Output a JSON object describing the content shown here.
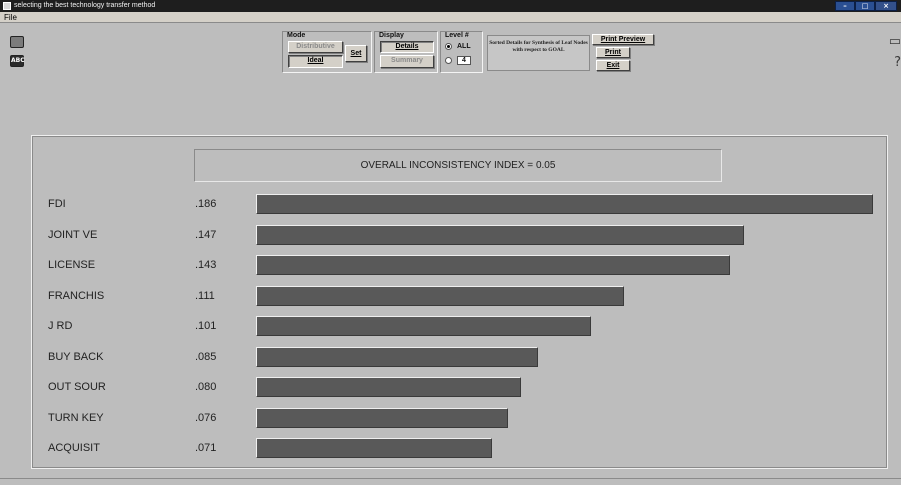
{
  "window": {
    "title": "selecting the best technology transfer method",
    "controls": {
      "minimize": "–",
      "maximize": "□",
      "close": "×"
    }
  },
  "menu": {
    "file": "File"
  },
  "toolbar_left": {
    "icon1": "screen-icon",
    "icon2": "abc-icon",
    "abc_label": "ABC"
  },
  "toolbar_right": {
    "icon1": "chat-icon",
    "icon2": "help-icon",
    "chat_glyph": "▭",
    "help_glyph": "?"
  },
  "controls": {
    "mode": {
      "title": "Mode",
      "distributive": "Distributive",
      "ideal": "Ideal",
      "set": "Set"
    },
    "display": {
      "title": "Display",
      "details": "Details",
      "summary": "Summary"
    },
    "level": {
      "title": "Level #",
      "all": "ALL",
      "number": "4",
      "selected": "ALL"
    },
    "sorted_text": "Sorted Details for Synthesis of Leaf Nodes with respect to GOAL",
    "actions": {
      "print_preview": "Print Preview",
      "print": "Print",
      "exit": "Exit"
    }
  },
  "main": {
    "inconsistency_label": "OVERALL INCONSISTENCY INDEX =",
    "inconsistency_value": "0.05",
    "max_value": 0.186,
    "rows": [
      {
        "name": "FDI",
        "value_text": ".186",
        "value": 0.186
      },
      {
        "name": "JOINT VE",
        "value_text": ".147",
        "value": 0.147
      },
      {
        "name": "LICENSE",
        "value_text": ".143",
        "value": 0.143
      },
      {
        "name": "FRANCHIS",
        "value_text": ".111",
        "value": 0.111
      },
      {
        "name": "J RD",
        "value_text": ".101",
        "value": 0.101
      },
      {
        "name": "BUY BACK",
        "value_text": ".085",
        "value": 0.085
      },
      {
        "name": "OUT SOUR",
        "value_text": ".080",
        "value": 0.08
      },
      {
        "name": "TURN KEY",
        "value_text": ".076",
        "value": 0.076
      },
      {
        "name": "ACQUISIT",
        "value_text": ".071",
        "value": 0.071
      }
    ]
  },
  "colors": {
    "bar": "#595959",
    "background": "#bdbdbd",
    "titlebar": "#1e1e1e"
  }
}
